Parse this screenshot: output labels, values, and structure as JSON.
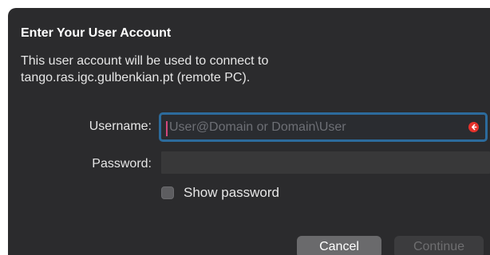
{
  "dialog": {
    "title": "Enter Your User Account",
    "description_line1": "This user account will be used to connect to",
    "description_line2": "tango.ras.igc.gulbenkian.pt (remote PC).",
    "username_label": "Username:",
    "username_placeholder": "User@Domain or Domain\\User",
    "username_value": "",
    "password_label": "Password:",
    "password_value": "",
    "show_password_label": "Show password",
    "show_password_checked": false,
    "cancel_label": "Cancel",
    "continue_label": "Continue",
    "continue_enabled": false,
    "icons": {
      "username_error": "error-icon"
    },
    "colors": {
      "background": "#2b2b2d",
      "focus_ring": "#2c6b9c",
      "error": "#e5312b",
      "caret": "#d4477c"
    }
  }
}
